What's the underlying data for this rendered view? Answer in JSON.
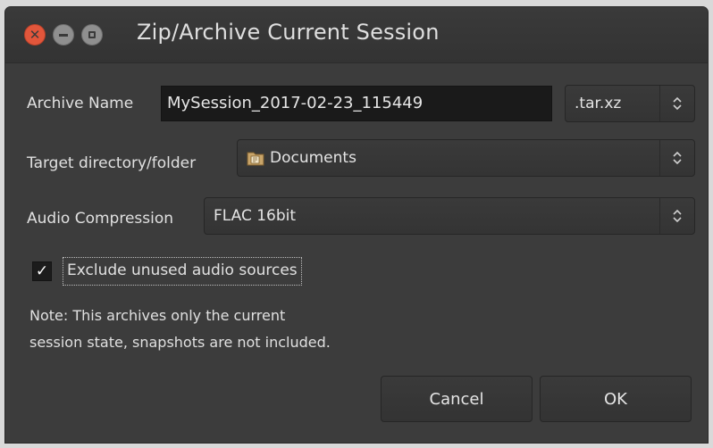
{
  "window": {
    "title": "Zip/Archive Current Session"
  },
  "form": {
    "archive_name_label": "Archive Name",
    "archive_name_value": "MySession_2017-02-23_115449",
    "extension_value": ".tar.xz",
    "target_label": "Target directory/folder",
    "target_value": "Documents",
    "compression_label": "Audio Compression",
    "compression_value": "FLAC 16bit",
    "exclude_label": "Exclude unused audio sources",
    "exclude_checked": true,
    "note_line1": "Note: This archives only the current",
    "note_line2": "session state, snapshots are not included."
  },
  "buttons": {
    "cancel_label": "Cancel",
    "ok_label": "OK"
  },
  "colors": {
    "close_button": "#e2563b",
    "window_bg": "#3c3c3c",
    "entry_bg": "#1a1a1a"
  },
  "icons": {
    "close": "close-icon",
    "minimize": "minimize-icon",
    "maximize": "maximize-icon",
    "folder": "folder-documents-icon",
    "combo_arrow": "up-down-chevron-icon",
    "check": "checkmark-icon"
  }
}
